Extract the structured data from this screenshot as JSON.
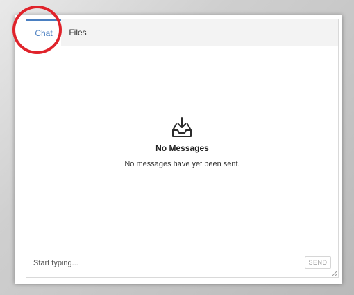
{
  "tabs": {
    "chat_label": "Chat",
    "files_label": "Files",
    "active": "Chat"
  },
  "empty_state": {
    "icon": "inbox-download-icon",
    "title": "No Messages",
    "subtitle": "No messages have yet been sent."
  },
  "composer": {
    "placeholder": "Start typing...",
    "value": "",
    "send_label": "SEND"
  },
  "colors": {
    "accent": "#4a7fc1",
    "highlight_ring": "#e0232b"
  }
}
